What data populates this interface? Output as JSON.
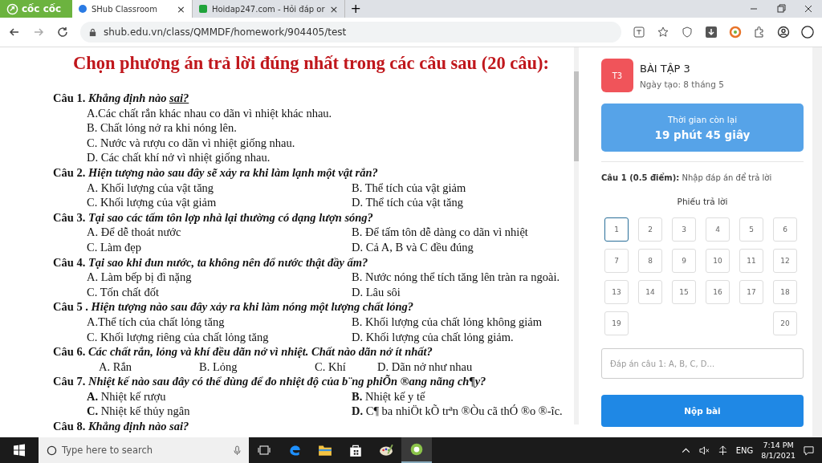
{
  "browser": {
    "brand": "cốc cốc",
    "tabs": [
      {
        "title": "SHub Classroom",
        "selected": true,
        "close": "×"
      },
      {
        "title": "Hoidap247.com - Hỏi đáp or",
        "selected": false,
        "close": "×"
      }
    ],
    "new_tab": "+",
    "url": "shub.edu.vn/class/QMMDF/homework/904405/test"
  },
  "document": {
    "heading": "Chọn phương án trả lời đúng nhất trong các câu sau (20 câu):",
    "questions": [
      {
        "label": "Câu 1.",
        "prompt": "Khẳng định nào",
        "emphasis": "sai?",
        "kind": "list",
        "options": [
          "A.Các chất rắn khác nhau co dãn vì nhiệt khác nhau.",
          "B. Chất lỏng nở ra khi nóng lên.",
          "C. Nước và rượu co dãn vì nhiệt giống nhau.",
          "D. Các chất khí nở vì nhiệt giống nhau."
        ]
      },
      {
        "label": "Câu 2.",
        "prompt": "Hiện tượng nào sau đây sẽ xảy ra khi làm lạnh một vật rắn?",
        "kind": "pairs",
        "options": [
          "A. Khối lượng của vật tăng",
          "B. Thể tích của vật giảm",
          "C.  Khối lượng của vật giảm",
          "D. Thể tích của vật tăng"
        ]
      },
      {
        "label": "Câu 3.",
        "prompt": "Tại sao các tấm tôn lợp nhà lại thường có dạng lượn sóng?",
        "kind": "pairs",
        "options": [
          "A. Để dễ thoát nước",
          "B. Để tấm tôn dễ dàng co dãn vì nhiệt",
          "C. Làm đẹp",
          "D. Cả A, B và C đều đúng"
        ]
      },
      {
        "label": "Câu 4.",
        "prompt": "Tại sao khi đun nước, ta không nên đổ nước thật đầy ấm?",
        "kind": "pairs",
        "options": [
          "A. Làm bếp bị đì nặng",
          "B. Nước nóng thể tích tăng lên tràn ra ngoài.",
          "C.  Tốn chất đốt",
          "D. Lâu sôi"
        ]
      },
      {
        "label": "Câu 5 .",
        "prompt": "Hiện tượng nào sau đây  xảy ra khi làm nóng một lượng chất lỏng?",
        "kind": "pairs",
        "options": [
          "A.Thể tích của chất lỏng tăng",
          "B. Khối lượng của chất lỏng không giảm",
          "C. Khối lượng riêng của chất lỏng tăng",
          "D. Khối lượng của chất lỏng giảm."
        ]
      },
      {
        "label": "Câu 6.",
        "prompt": "Các chất rắn, lỏng và khí đều dãn nở vì nhiệt. Chất nào dãn nở ít nhất?",
        "kind": "row",
        "options": [
          "A. Rắn",
          "B. Lỏng",
          "C. Khí",
          "D. Dãn nở như nhau"
        ]
      },
      {
        "label": "Câu 7.",
        "prompt": "Nhiệt kế nào sau đây có thể dùng để đo nhiệt độ của b¨ng phiÕn ®ang nãng ch¶y?",
        "kind": "pairs",
        "options": [
          "**A.** Nhiệt kế rượu",
          "**B.** Nhiệt kế y tế",
          "**C.** Nhiệt kế thủy ngân",
          "**D.** C¶ ba nhiÖt kÕ trªn ®Òu cã thÓ ®o ®-îc."
        ]
      },
      {
        "label": "Câu 8.",
        "prompt": "Khẳng định nào sai?"
      }
    ]
  },
  "panel": {
    "badge": "T3",
    "title": "BÀI TẬP 3",
    "date": "Ngày tạo: 8 tháng 5",
    "timer": {
      "label": "Thời gian còn lại",
      "value": "19 phút 45 giây"
    },
    "question_info": "**Câu 1 (0.5 điểm):** Nhập đáp án để trả lời",
    "sheet_title": "Phiếu trả lời",
    "answers": [
      {
        "n": "1",
        "selected": true
      },
      {
        "n": "2",
        "selected": false
      },
      {
        "n": "3",
        "selected": false
      },
      {
        "n": "4",
        "selected": false
      },
      {
        "n": "5",
        "selected": false
      },
      {
        "n": "6",
        "selected": false
      },
      {
        "n": "7",
        "selected": false
      },
      {
        "n": "8",
        "selected": false
      },
      {
        "n": "9",
        "selected": false
      },
      {
        "n": "10",
        "selected": false
      },
      {
        "n": "11",
        "selected": false
      },
      {
        "n": "12",
        "selected": false
      },
      {
        "n": "13",
        "selected": false
      },
      {
        "n": "14",
        "selected": false
      },
      {
        "n": "15",
        "selected": false
      },
      {
        "n": "16",
        "selected": false
      },
      {
        "n": "17",
        "selected": false
      },
      {
        "n": "18",
        "selected": false
      },
      {
        "n": "19",
        "selected": false
      },
      {
        "n": "20",
        "selected": false
      }
    ],
    "answer_field": {
      "placeholder": "Đáp án câu 1: A, B, C, D..."
    },
    "submit": "Nộp bài"
  },
  "taskbar": {
    "search": {
      "placeholder": "Type here to search"
    },
    "language": "ENG",
    "time": "7:14 PM",
    "date": "8/1/2021"
  }
}
